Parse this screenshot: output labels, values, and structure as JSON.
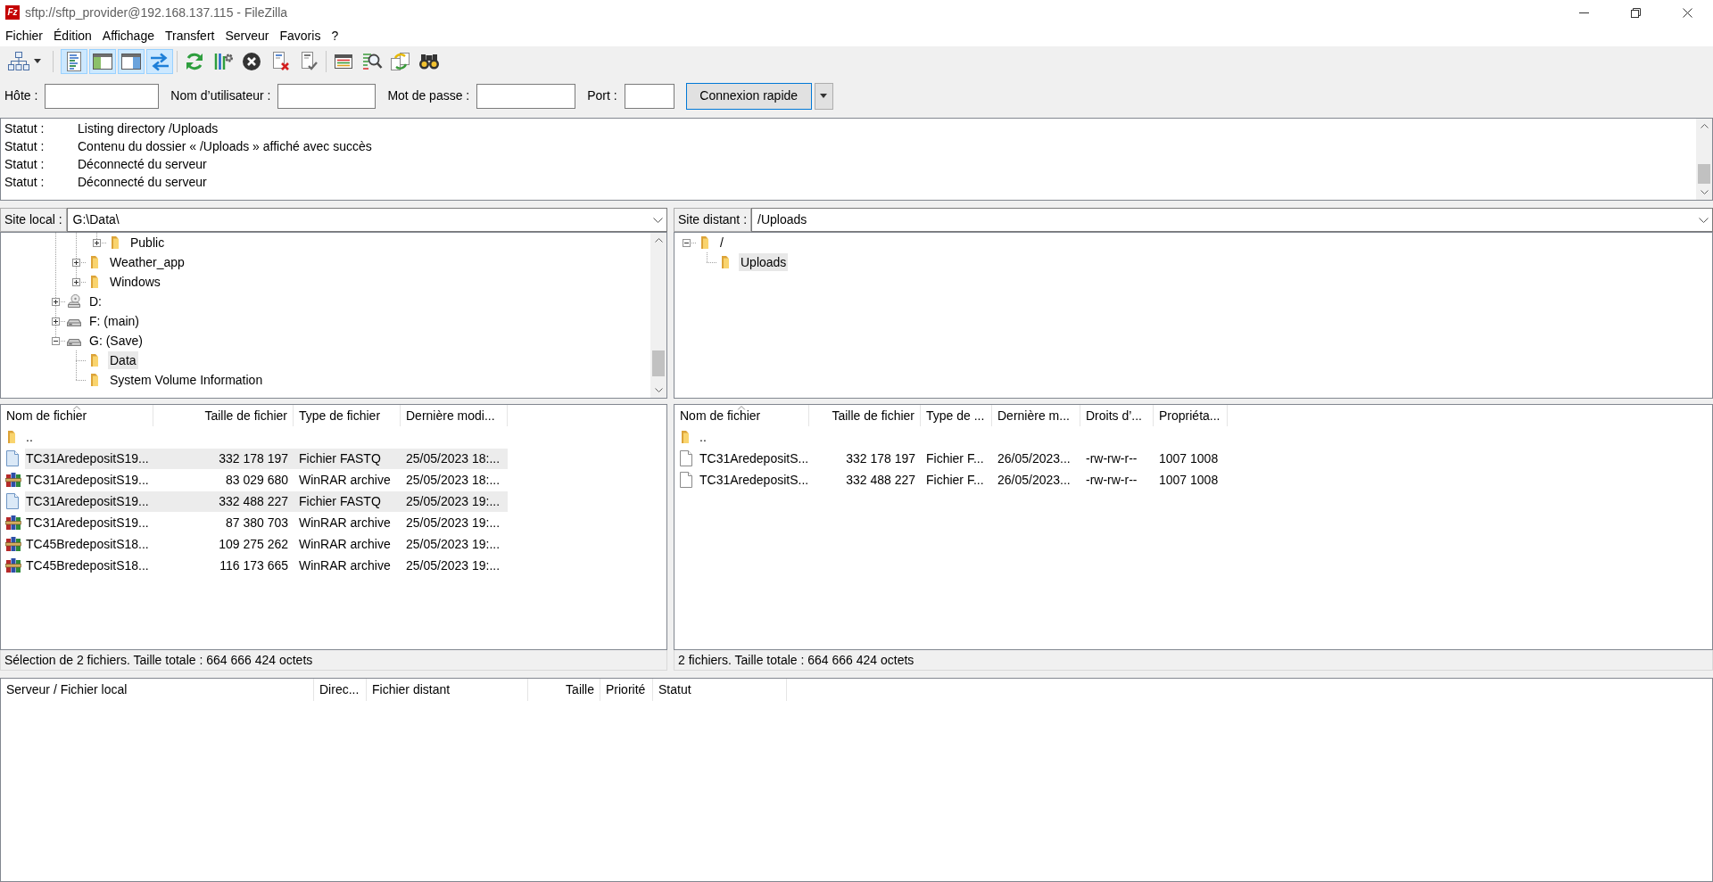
{
  "window": {
    "icon_text": "Fz",
    "title": "sftp://sftp_provider@192.168.137.115 - FileZilla"
  },
  "menu": [
    "Fichier",
    "Édition",
    "Affichage",
    "Transfert",
    "Serveur",
    "Favoris",
    "?"
  ],
  "toolbar": [
    {
      "buttons": [
        {
          "kind": "sitemanager",
          "pressed": false
        }
      ]
    },
    {
      "buttons": [
        {
          "kind": "log",
          "pressed": true
        },
        {
          "kind": "localtree",
          "pressed": true
        },
        {
          "kind": "remotetree",
          "pressed": true
        },
        {
          "kind": "queue",
          "pressed": true
        }
      ]
    },
    {
      "buttons": [
        {
          "kind": "refresh",
          "pressed": false
        },
        {
          "kind": "process",
          "pressed": false
        },
        {
          "kind": "cancel",
          "pressed": false
        },
        {
          "kind": "disconnect",
          "pressed": false
        },
        {
          "kind": "reconnect",
          "pressed": false
        }
      ]
    },
    {
      "buttons": [
        {
          "kind": "filter",
          "pressed": false
        },
        {
          "kind": "compare",
          "pressed": false
        },
        {
          "kind": "sync",
          "pressed": false
        },
        {
          "kind": "search",
          "pressed": false
        }
      ]
    }
  ],
  "quickconnect": {
    "fields": [
      {
        "label": "Hôte :"
      },
      {
        "label": "Nom d’utilisateur :"
      },
      {
        "label": "Mot de passe :"
      },
      {
        "label": "Port :"
      }
    ],
    "button": "Connexion rapide"
  },
  "log": [
    {
      "label": "Statut :",
      "message": "Listing directory /Uploads"
    },
    {
      "label": "Statut :",
      "message": "Contenu du dossier « /Uploads » affiché avec succès"
    },
    {
      "label": "Statut :",
      "message": "Déconnecté du serveur"
    },
    {
      "label": "Statut :",
      "message": "Déconnecté du serveur"
    }
  ],
  "local": {
    "site_label": "Site local :",
    "path": "G:\\Data\\",
    "tree": [
      {
        "children": [
          {
            "children": [
              {
                "label": "Public",
                "kind": "folder",
                "expanded": false,
                "selected": false
              }
            ]
          },
          {
            "label": "Weather_app",
            "kind": "folder",
            "expanded": false,
            "selected": false
          },
          {
            "label": "Windows",
            "kind": "folder",
            "expanded": false,
            "selected": false
          }
        ]
      },
      {
        "label": "D:",
        "kind": "disc",
        "expanded": false,
        "selected": false
      },
      {
        "label": "F: (main)",
        "kind": "drive",
        "expanded": false,
        "selected": false
      },
      {
        "label": "G: (Save)",
        "kind": "drive",
        "expanded": true,
        "selected": false,
        "children": [
          {
            "label": "Data",
            "kind": "folder",
            "selected": true
          },
          {
            "label": "System Volume Information",
            "kind": "folder",
            "selected": false
          }
        ]
      }
    ],
    "columns": [
      {
        "label": "Nom de fichier",
        "sorted": true
      },
      {
        "label": "Taille de fichier",
        "sorted": false
      },
      {
        "label": "Type de fichier",
        "sorted": false
      },
      {
        "label": "Dernière modi...",
        "sorted": false
      }
    ],
    "rows": [
      {
        "kind": "folder",
        "selected": false,
        "cells": [
          ".."
        ]
      },
      {
        "kind": "datafile",
        "selected": true,
        "cells": [
          "TC31AredepositS19...",
          "332 178 197",
          "Fichier FASTQ",
          "25/05/2023 18:..."
        ]
      },
      {
        "kind": "archive",
        "selected": false,
        "cells": [
          "TC31AredepositS19...",
          "83 029 680",
          "WinRAR archive",
          "25/05/2023 18:..."
        ]
      },
      {
        "kind": "datafile",
        "selected": true,
        "cells": [
          "TC31AredepositS19...",
          "332 488 227",
          "Fichier FASTQ",
          "25/05/2023 19:..."
        ]
      },
      {
        "kind": "archive",
        "selected": false,
        "cells": [
          "TC31AredepositS19...",
          "87 380 703",
          "WinRAR archive",
          "25/05/2023 19:..."
        ]
      },
      {
        "kind": "archive",
        "selected": false,
        "cells": [
          "TC45BredepositS18...",
          "109 275 262",
          "WinRAR archive",
          "25/05/2023 19:..."
        ]
      },
      {
        "kind": "archive",
        "selected": false,
        "cells": [
          "TC45BredepositS18...",
          "116 173 665",
          "WinRAR archive",
          "25/05/2023 19:..."
        ]
      }
    ],
    "status": "Sélection de 2 fichiers. Taille totale : 664 666 424 octets"
  },
  "remote": {
    "site_label": "Site distant :",
    "path": "/Uploads",
    "tree": [
      {
        "label": "/",
        "kind": "folder",
        "expanded": true,
        "selected": false,
        "children": [
          {
            "label": "Uploads",
            "kind": "folder",
            "selected": true
          }
        ]
      }
    ],
    "columns": [
      {
        "label": "Nom de fichier",
        "sorted": true
      },
      {
        "label": "Taille de fichier",
        "sorted": false
      },
      {
        "label": "Type de ...",
        "sorted": false
      },
      {
        "label": "Dernière m...",
        "sorted": false
      },
      {
        "label": "Droits d’...",
        "sorted": false
      },
      {
        "label": "Propriéta...",
        "sorted": false
      }
    ],
    "rows": [
      {
        "kind": "folder",
        "selected": false,
        "cells": [
          ".."
        ]
      },
      {
        "kind": "file",
        "selected": false,
        "cells": [
          "TC31AredepositS...",
          "332 178 197",
          "Fichier F...",
          "26/05/2023...",
          "-rw-rw-r--",
          "1007 1008"
        ]
      },
      {
        "kind": "file",
        "selected": false,
        "cells": [
          "TC31AredepositS...",
          "332 488 227",
          "Fichier F...",
          "26/05/2023...",
          "-rw-rw-r--",
          "1007 1008"
        ]
      }
    ],
    "status": "2 fichiers. Taille totale : 664 666 424 octets"
  },
  "queue": {
    "columns": [
      {
        "label": "Serveur / Fichier local"
      },
      {
        "label": "Direc..."
      },
      {
        "label": "Fichier distant"
      },
      {
        "label": "Taille"
      },
      {
        "label": "Priorité"
      },
      {
        "label": "Statut"
      }
    ]
  }
}
